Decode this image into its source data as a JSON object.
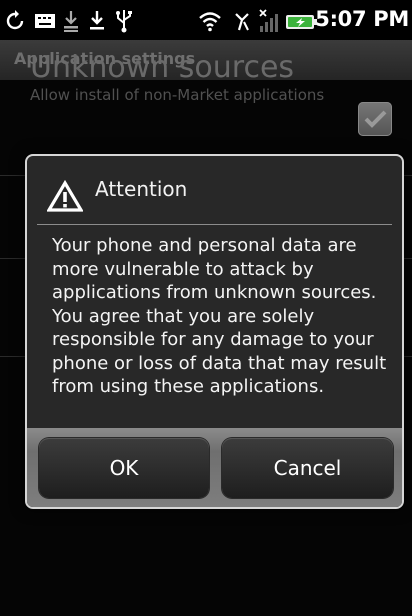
{
  "status_bar": {
    "time": "5:07 PM",
    "icons": [
      "sync-icon",
      "keyboard-icon",
      "download-done-icon",
      "download-icon",
      "usb-icon",
      "wifi-icon",
      "no-signal-icon",
      "signal-icon",
      "battery-charging-icon"
    ]
  },
  "app": {
    "title": "Application settings",
    "setting": {
      "title": "Unknown sources",
      "summary": "Allow install of non-Market applications",
      "checked": true
    }
  },
  "dialog": {
    "icon": "alert-triangle-icon",
    "title": "Attention",
    "message": "Your phone and personal data are more vulnerable to attack by applications from unknown sources. You agree that you are solely responsible for any damage to your phone or loss of data that may result from using these applications.",
    "ok_label": "OK",
    "cancel_label": "Cancel"
  },
  "colors": {
    "dialog_background": "#282828",
    "dialog_border": "#d6d6d6",
    "button_bar": "#7e7e7e",
    "battery_charging": "#3cb33c"
  }
}
